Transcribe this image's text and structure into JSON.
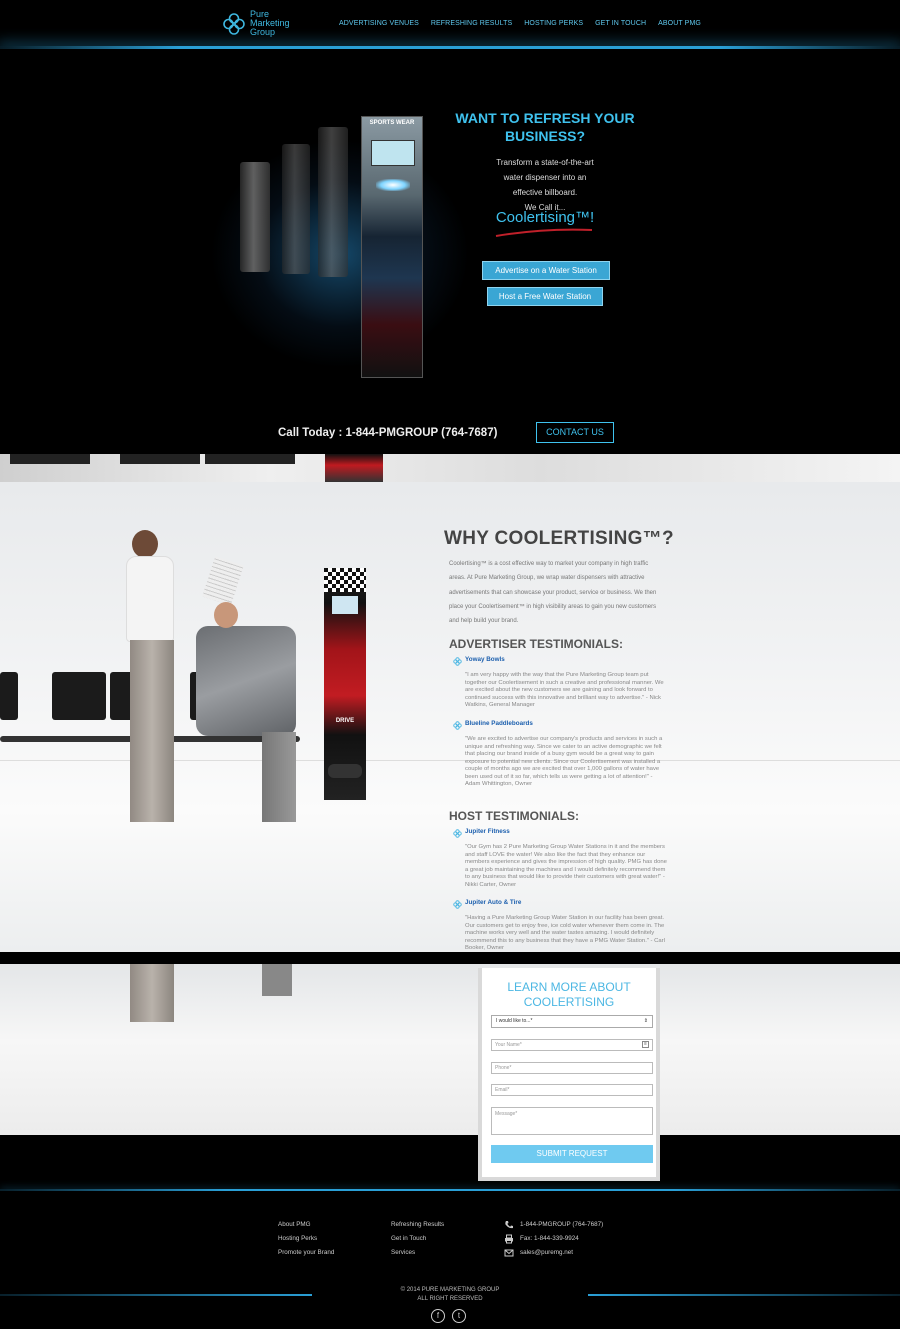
{
  "brand": {
    "logo_line1": "Pure",
    "logo_line2": "Marketing",
    "logo_line3": "Group",
    "accent": "#3fc2ee"
  },
  "nav": {
    "items": [
      "ADVERTISING VENUES",
      "REFRESHING RESULTS",
      "HOSTING PERKS",
      "GET IN TOUCH",
      "ABOUT PMG"
    ]
  },
  "hero": {
    "headline": "WANT TO REFRESH YOUR BUSINESS?",
    "body_l1": "Transform a state-of-the-art",
    "body_l2": "water dispenser into an",
    "body_l3": "effective billboard.",
    "body_l4": "We Call it...",
    "coolertising": "Coolertising™!",
    "btn_advertise": "Advertise on a Water Station",
    "btn_host": "Host a Free Water Station",
    "dispenser_top": "SPORTS WEAR",
    "call_today": "Call Today : 1-844-PMGROUP (764-7687)",
    "contact_btn": "CONTACT US"
  },
  "why": {
    "heading": "WHY COOLERTISING™?",
    "body": "Coolertising™ is a cost effective way to market your company in high traffic areas. At Pure Marketing Group, we wrap water dispensers with attractive advertisements that can showcase your product, service or business. We then place your Coolertisement™ in high visibility areas to gain you new customers and help build your brand.",
    "advertiser_heading": "ADVERTISER TESTIMONIALS:",
    "host_heading": "HOST TESTIMONIALS:",
    "advertiser": [
      {
        "company": "Yoway Bowls",
        "quote": "\"I am very happy with the way that the Pure Marketing Group team put together our Coolertisement in such a creative and professional manner. We are excited about the new customers we are gaining and look forward to continued success with this innovative and brilliant way to advertise.\" - Nick Watkins, General Manager"
      },
      {
        "company": "Blueline Paddleboards",
        "quote": "\"We are excited to advertise our company's products and services in such a unique and refreshing way. Since we cater to an active demographic we felt that placing our brand inside of a busy gym would be a great way to gain exposure to potential new clients. Since our Coolertisement was installed a couple of months ago we are excited that over 1,000 gallons of water have been used out of it so far, which tells us were getting a lot of attention!\" - Adam Whittington, Owner"
      }
    ],
    "host": [
      {
        "company": "Jupiter Fitness",
        "quote": "\"Our Gym has 2 Pure Marketing Group Water Stations in it and the members and staff LOVE the water! We also like the fact that they enhance our members experience and gives the impression of high quality.  PMG has done a great job maintaining the machines and I would definitely recommend them to any business that would like to provide their customers with great water!\" - Nikki Carter, Owner"
      },
      {
        "company": "Jupiter Auto & Tire",
        "quote": "\"Having a Pure Marketing Group Water Station in our facility has been great.  Our customers get to enjoy free, ice cold water whenever them come in.  The machine works very well and the water tastes amazing.  I would definitely recommend this to any business that they have a PMG Water Station.\" - Carl Booker, Owner"
      }
    ]
  },
  "scene": {
    "ad_brand": "DRIVE"
  },
  "form": {
    "heading_l1": "LEARN MORE ABOUT",
    "heading_l2": "COOLERTISING",
    "select_value": "I would like to...*",
    "name_placeholder": "Your Name*",
    "phone_placeholder": "Phone*",
    "email_placeholder": "Email*",
    "message_placeholder": "Message*",
    "submit": "SUBMIT REQUEST"
  },
  "footer": {
    "col1": [
      "About PMG",
      "Hosting Perks",
      "Promote your Brand"
    ],
    "col2": [
      "Refreshing Results",
      "Get in Touch",
      "Services"
    ],
    "phone": "1-844-PMGROUP (764-7687)",
    "fax": "Fax:  1-844-339-9924",
    "email": "sales@puremg.net",
    "copyright_l1": "© 2014 PURE MARKETING GROUP",
    "copyright_l2": "ALL RIGHT RESERVED"
  }
}
